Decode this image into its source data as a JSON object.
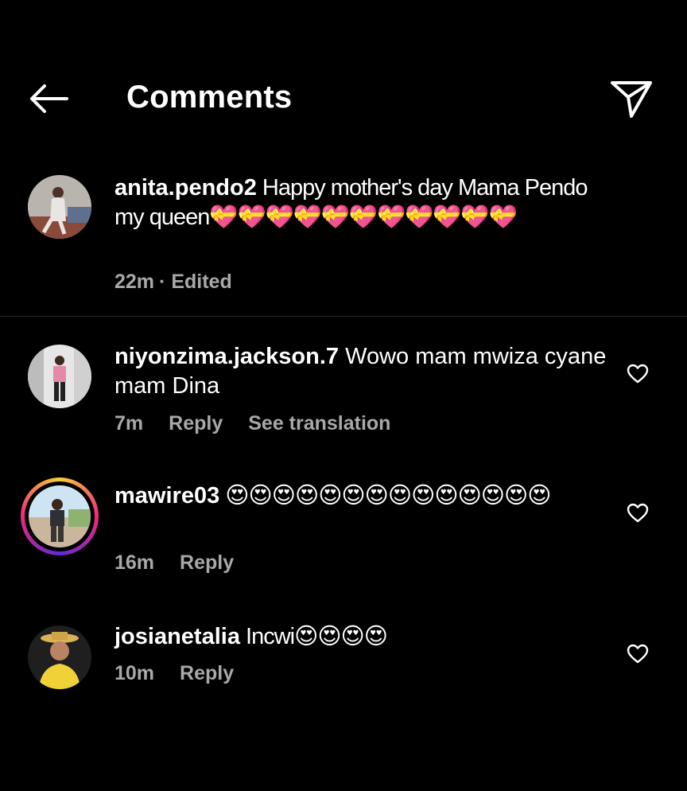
{
  "header": {
    "title": "Comments"
  },
  "comments": [
    {
      "username": "anita.pendo2",
      "text": " Happy mother's day Mama Pendo  my queen💝💝💝💝💝💝💝💝💝💝💝",
      "time": "22m",
      "edited_label": "· Edited"
    },
    {
      "username": "niyonzima.jackson.7",
      "text": " Wowo mam mwiza cyane mam Dina",
      "time": "7m",
      "reply_label": "Reply",
      "translation_label": "See translation"
    },
    {
      "username": "mawire03",
      "text": " 😍😍😍😍😍😍😍😍😍😍😍😍😍😍",
      "time": "16m",
      "reply_label": "Reply"
    },
    {
      "username": "josianetalia",
      "text": " Incwi😍😍😍😍",
      "time": "10m",
      "reply_label": "Reply"
    }
  ],
  "colors": {
    "background": "#000000",
    "meta_text": "#a8a8a8",
    "story_ring_start": "#f9ce34",
    "story_ring_mid": "#ee2a7b",
    "story_ring_end": "#6228d7"
  },
  "icons": [
    "back-arrow-icon",
    "send-icon",
    "heart-icon"
  ]
}
